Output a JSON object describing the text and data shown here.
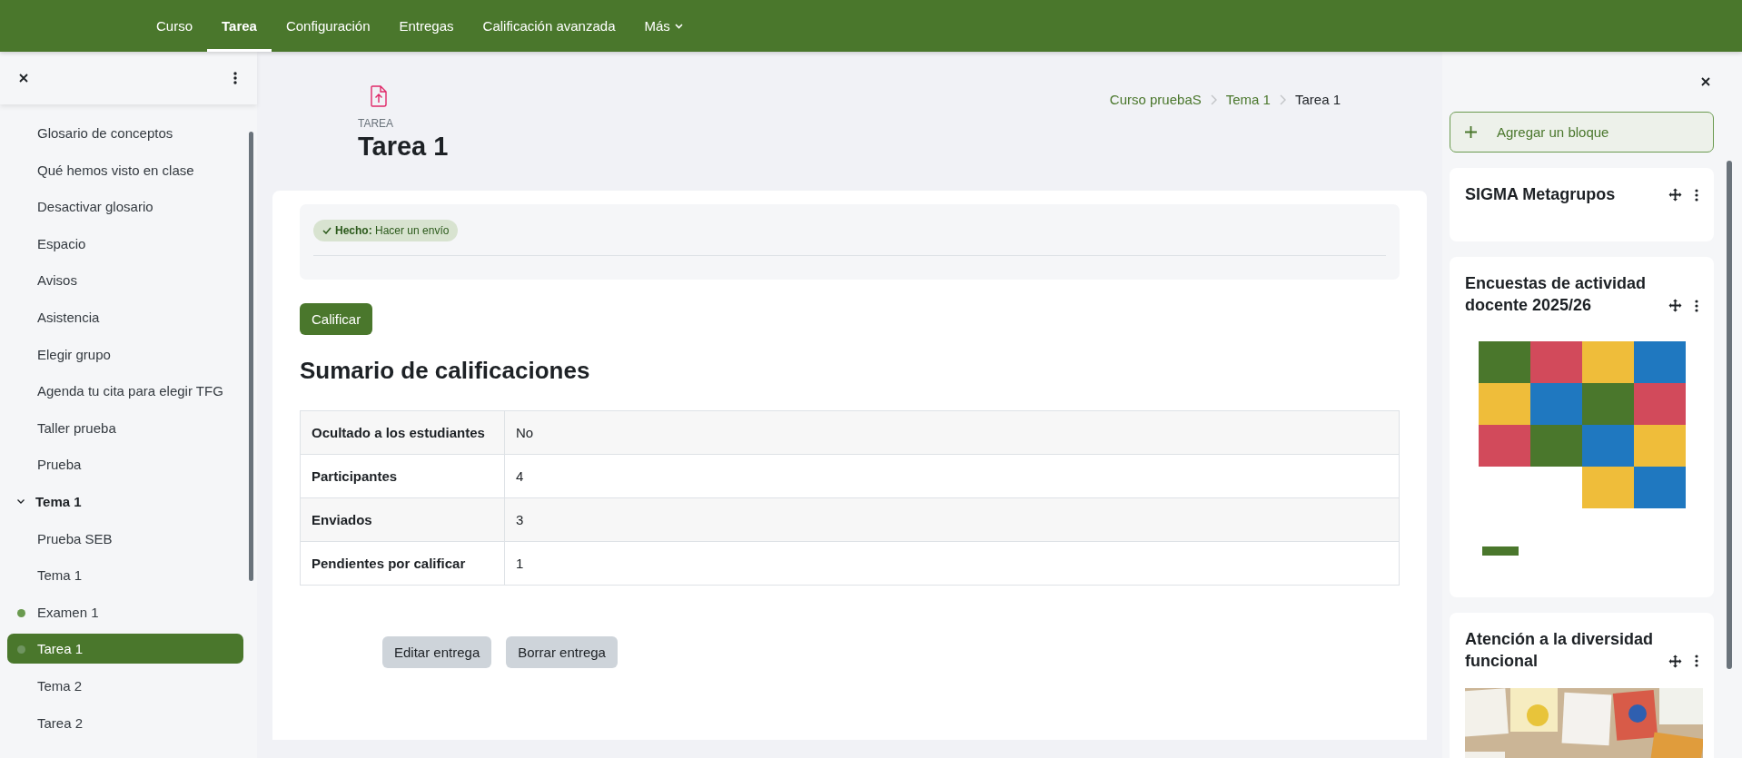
{
  "nav": [
    {
      "label": "Curso",
      "selected": false,
      "kind": "link"
    },
    {
      "label": "Tarea",
      "selected": true,
      "kind": "link"
    },
    {
      "label": "Configuración",
      "selected": false,
      "kind": "link"
    },
    {
      "label": "Entregas",
      "selected": false,
      "kind": "link"
    },
    {
      "label": "Calificación avanzada",
      "selected": false,
      "kind": "link"
    },
    {
      "label": "Más",
      "selected": false,
      "kind": "dropdown"
    }
  ],
  "sidebar": {
    "sections": [
      {
        "items": [
          {
            "label": "Glosario de conceptos",
            "selected": false,
            "marked": false
          },
          {
            "label": "Qué hemos visto en clase",
            "selected": false,
            "marked": false
          },
          {
            "label": "Desactivar glosario",
            "selected": false,
            "marked": false
          },
          {
            "label": "Espacio",
            "selected": false,
            "marked": false
          },
          {
            "label": "Avisos",
            "selected": false,
            "marked": false
          },
          {
            "label": "Asistencia",
            "selected": false,
            "marked": false
          },
          {
            "label": "Elegir grupo",
            "selected": false,
            "marked": false
          },
          {
            "label": "Agenda tu cita para elegir TFG",
            "selected": false,
            "marked": false
          },
          {
            "label": "Taller prueba",
            "selected": false,
            "marked": false
          },
          {
            "label": "Prueba",
            "selected": false,
            "marked": false
          }
        ]
      },
      {
        "title": "Tema 1",
        "expanded": true,
        "items": [
          {
            "label": "Prueba SEB",
            "selected": false,
            "marked": false
          },
          {
            "label": "Tema 1",
            "selected": false,
            "marked": false
          },
          {
            "label": "Examen 1",
            "selected": false,
            "marked": true
          },
          {
            "label": "Tarea 1",
            "selected": true,
            "marked": true
          },
          {
            "label": "Tema 2",
            "selected": false,
            "marked": false
          },
          {
            "label": "Tarea 2",
            "selected": false,
            "marked": false
          }
        ]
      }
    ]
  },
  "header": {
    "kind_label": "TAREA",
    "title": "Tarea 1"
  },
  "breadcrumb": [
    {
      "label": "Curso pruebaS",
      "kind": "link"
    },
    {
      "label": "Tema 1",
      "kind": "link"
    },
    {
      "label": "Tarea 1",
      "kind": "current"
    }
  ],
  "completion": {
    "text": "**Hecho:** Hacer un envío",
    "done": true
  },
  "grade_button": "Calificar",
  "summary": {
    "heading": "Sumario de calificaciones",
    "rows": [
      {
        "label": "Ocultado a los estudiantes",
        "value": "No"
      },
      {
        "label": "Participantes",
        "value": "4"
      },
      {
        "label": "Enviados",
        "value": "3"
      },
      {
        "label": "Pendientes por calificar",
        "value": "1"
      }
    ]
  },
  "actions": [
    "Editar entrega",
    "Borrar entrega"
  ],
  "blocks_panel": {
    "add_button": "Agregar un bloque",
    "blocks": [
      {
        "title": "SIGMA Metagrupos",
        "kind": "empty"
      },
      {
        "title": "Encuestas de actividad docente 2025/26",
        "kind": "poster"
      },
      {
        "title": "Atención a la diversidad funcional",
        "kind": "collage"
      }
    ]
  }
}
